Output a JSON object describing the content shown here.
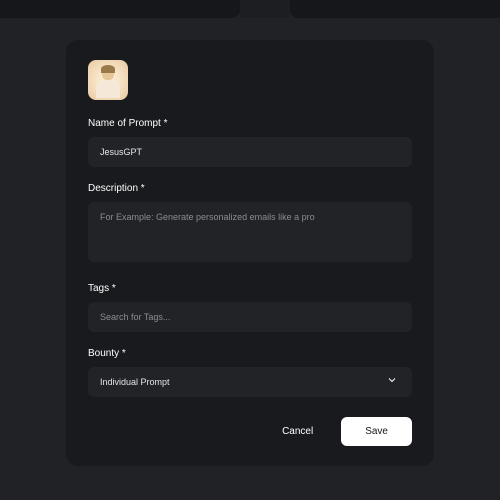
{
  "form": {
    "name": {
      "label": "Name of Prompt *",
      "value": "JesusGPT"
    },
    "description": {
      "label": "Description *",
      "placeholder": "For Example: Generate personalized emails like a pro"
    },
    "tags": {
      "label": "Tags *",
      "placeholder": "Search for Tags..."
    },
    "bounty": {
      "label": "Bounty *",
      "selected": "Individual Prompt"
    }
  },
  "buttons": {
    "cancel": "Cancel",
    "save": "Save"
  }
}
